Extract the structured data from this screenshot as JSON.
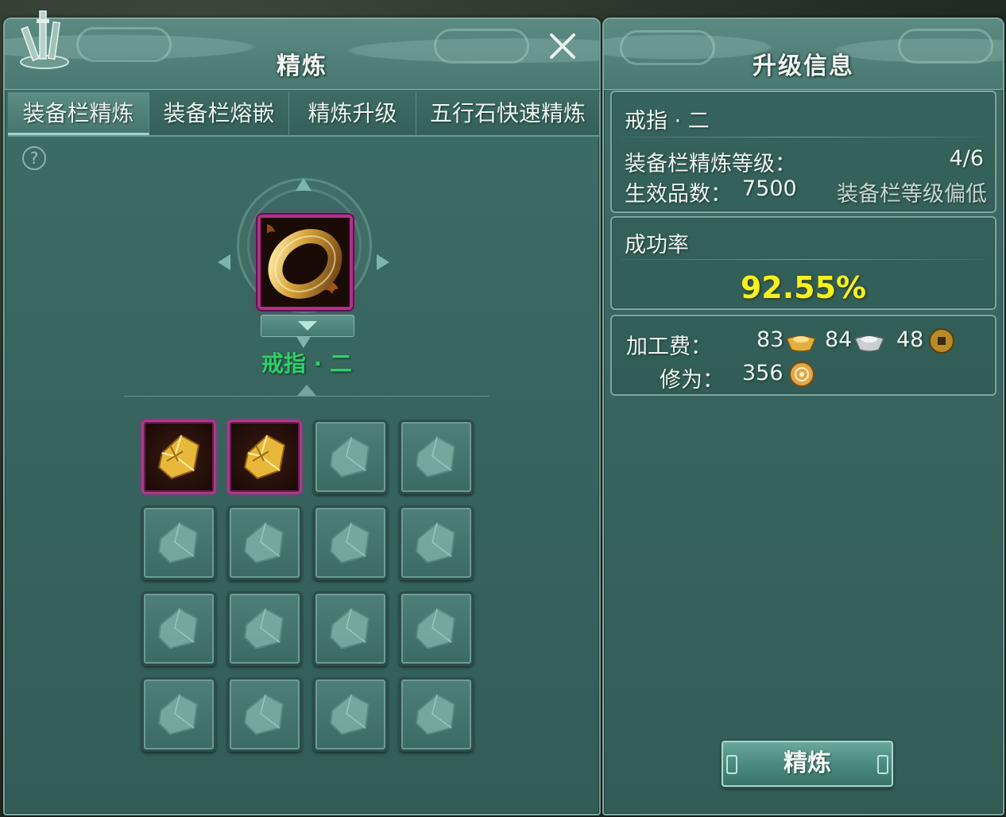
{
  "refine_panel": {
    "title": "精炼",
    "tabs": [
      "装备栏精炼",
      "装备栏熔嵌",
      "精炼升级",
      "五行石快速精炼"
    ],
    "active_tab": 0,
    "help_label": "?",
    "equipped_item": {
      "name": "戒指 · 二",
      "icon": "gold-ring-icon",
      "rarity_color": "#b1308e",
      "name_color": "#2fd16a"
    },
    "material_slots": [
      {
        "filled": true,
        "icon": "gold-refine-stone-icon"
      },
      {
        "filled": true,
        "icon": "gold-refine-stone-icon"
      },
      {
        "filled": false
      },
      {
        "filled": false
      },
      {
        "filled": false
      },
      {
        "filled": false
      },
      {
        "filled": false
      },
      {
        "filled": false
      },
      {
        "filled": false
      },
      {
        "filled": false
      },
      {
        "filled": false
      },
      {
        "filled": false
      },
      {
        "filled": false
      },
      {
        "filled": false
      },
      {
        "filled": false
      },
      {
        "filled": false
      }
    ]
  },
  "upgrade_info": {
    "title": "升级信息",
    "item_name": "戒指 · 二",
    "slot_refine_level_label": "装备栏精炼等级：",
    "slot_refine_level_value": "4/6",
    "effective_quality_label": "生效品数：",
    "effective_quality_value": "7500",
    "warning": "装备栏等级偏低",
    "success_rate_label": "成功率",
    "success_rate_value": "92.55%",
    "fee_label": "加工费：",
    "fee_gold": "83",
    "fee_silver": "84",
    "fee_copper": "48",
    "cultivation_label": "修为：",
    "cultivation_value": "356",
    "refine_button": "精炼"
  },
  "colors": {
    "accent_yellow": "#f4f21e",
    "panel_teal": "#386660",
    "item_green": "#2fd16a"
  }
}
